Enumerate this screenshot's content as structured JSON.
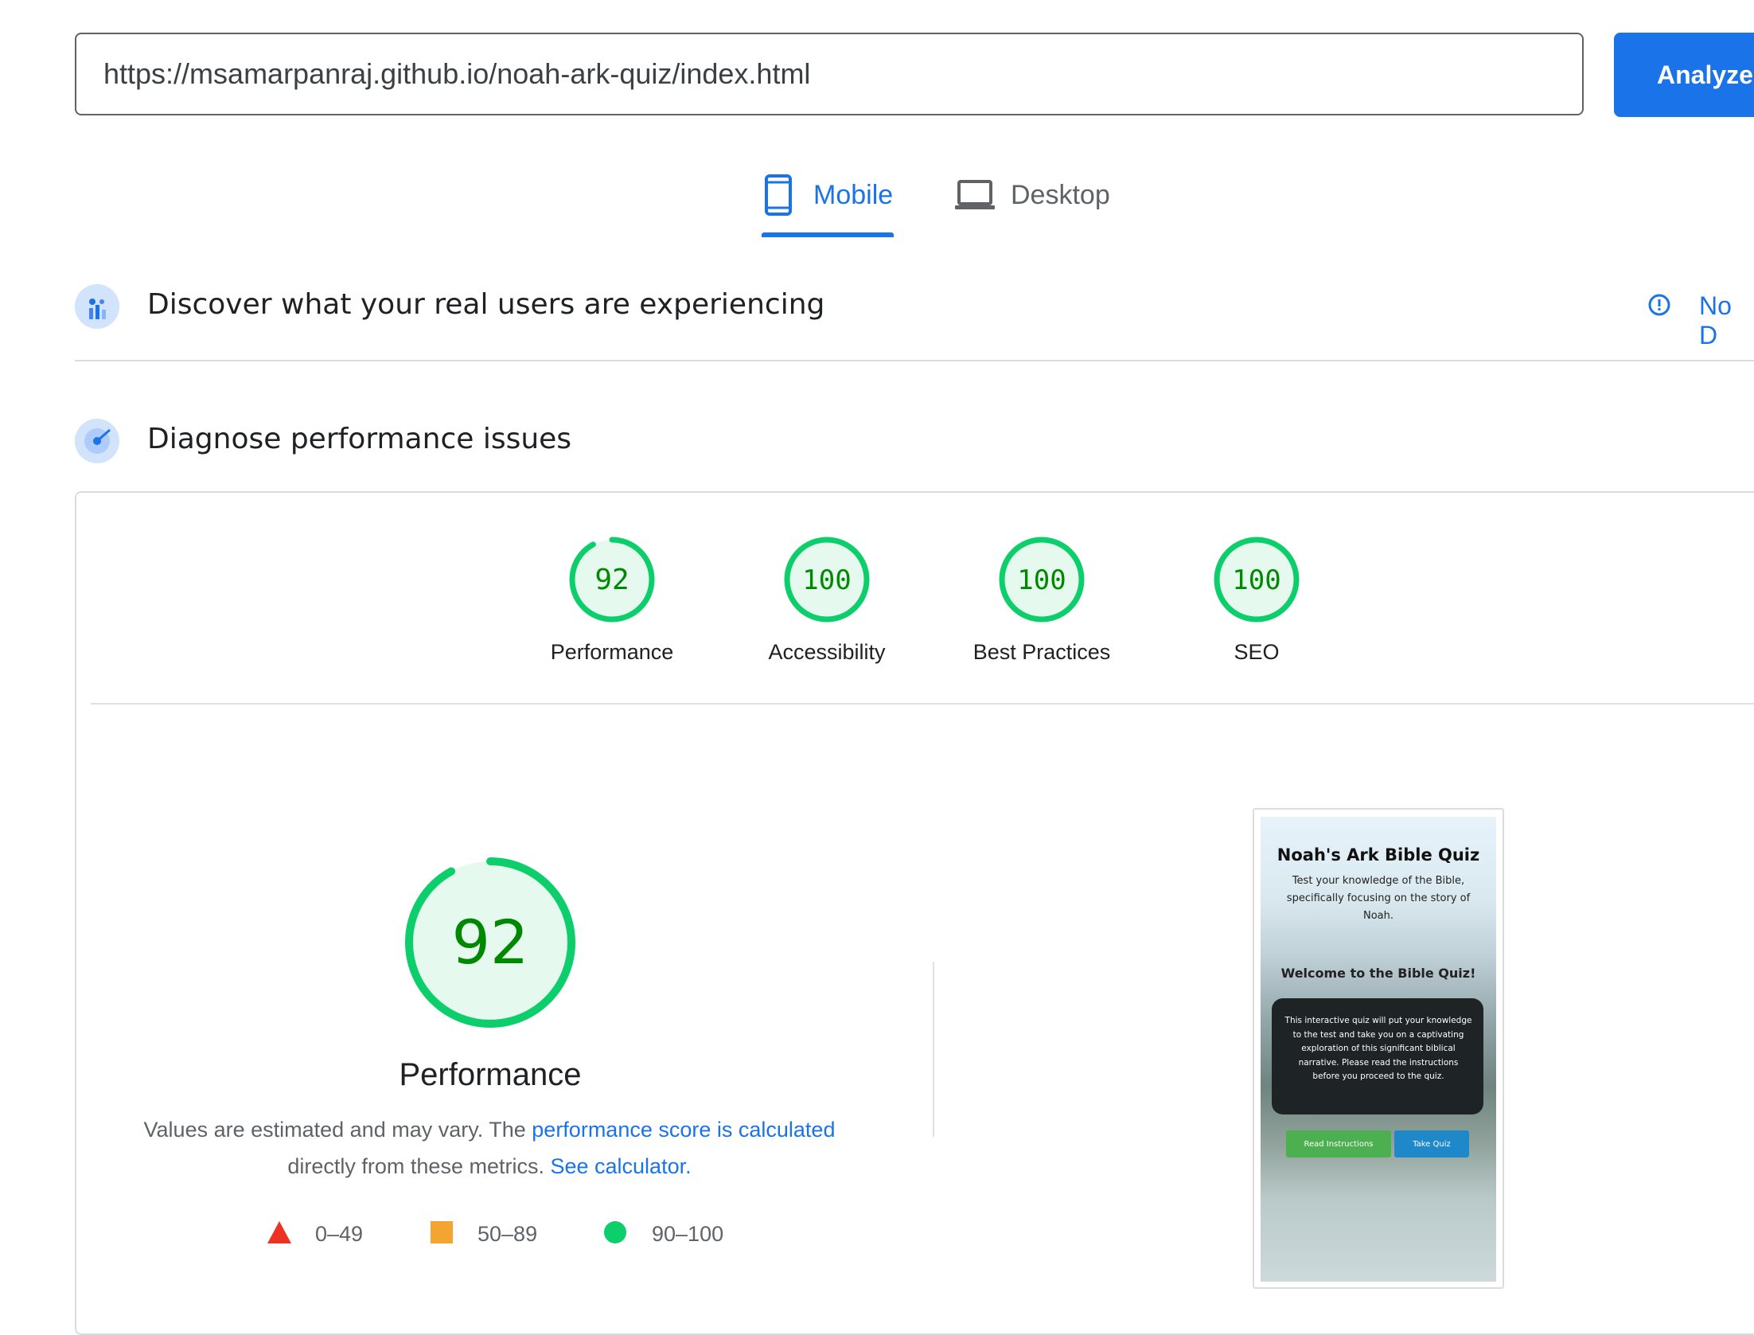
{
  "search": {
    "url": "https://msamarpanraj.github.io/noah-ark-quiz/index.html",
    "button_label": "Analyze"
  },
  "tabs": [
    {
      "label": "Mobile",
      "icon": "smartphone-icon",
      "selected": true
    },
    {
      "label": "Desktop",
      "icon": "laptop-icon",
      "selected": false
    }
  ],
  "field_data": {
    "title": "Discover what your real users are experiencing",
    "status_label": "No D"
  },
  "lab_data": {
    "title": "Diagnose performance issues"
  },
  "scores": [
    {
      "label": "Performance",
      "score": "92",
      "value": 92
    },
    {
      "label": "Accessibility",
      "score": "100",
      "value": 100
    },
    {
      "label": "Best Practices",
      "score": "100",
      "value": 100
    },
    {
      "label": "SEO",
      "score": "100",
      "value": 100
    }
  ],
  "performance": {
    "score": "92",
    "value": 92,
    "label": "Performance",
    "desc_prefix": "Values are estimated and may vary. The ",
    "desc_link": "performance score is calculated",
    "desc_middle": "directly from these metrics.",
    "desc_link2": "See calculator."
  },
  "legend": [
    {
      "range": "0–49",
      "shape": "triangle",
      "color": "#eb3223"
    },
    {
      "range": "50–89",
      "shape": "square",
      "color": "#f4a531"
    },
    {
      "range": "90–100",
      "shape": "circle",
      "color": "#0cce6b"
    }
  ],
  "screenshot": {
    "title": "Noah's Ark Bible Quiz",
    "subtitle": "Test your knowledge of the Bible, specifically focusing on the story of Noah.",
    "welcome": "Welcome to the Bible Quiz!",
    "body": "This interactive quiz will put your knowledge to the test and take you on a captivating exploration of this significant biblical narrative. Please read the instructions before you proceed to the quiz.",
    "button_instructions": "Read Instructions",
    "button_quiz": "Take Quiz"
  },
  "colors": {
    "accent": "#1a73e8",
    "pass": "#0cce6b",
    "pass_text": "#008800",
    "pass_fill": "#e6f9ee"
  }
}
